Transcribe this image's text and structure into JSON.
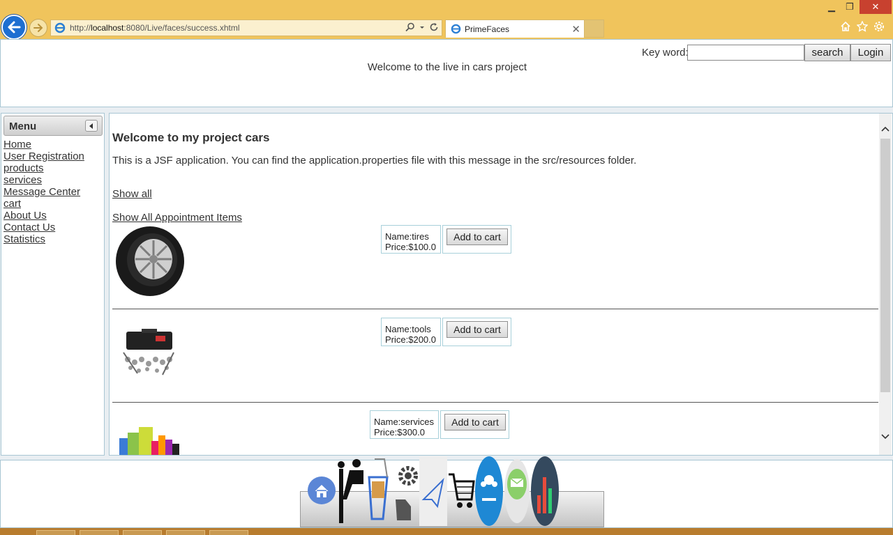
{
  "browser": {
    "url_prefix": "http://",
    "url_host": "localhost",
    "url_rest": ":8080/Live/faces/success.xhtml",
    "tab_title": "PrimeFaces",
    "accent": "#f0c45c"
  },
  "header": {
    "keyword_label": "Key word:",
    "keyword_value": "",
    "search_label": "search",
    "login_label": "Login",
    "welcome": "Welcome to the live in cars project"
  },
  "menu": {
    "title": "Menu",
    "items": [
      "Home",
      "User Registration",
      "products",
      "services",
      "Message Center",
      "cart",
      "About Us",
      "Contact Us",
      "Statistics"
    ]
  },
  "content": {
    "title": "Welcome to my project cars",
    "description": "This is a JSF application. You can find the application.properties file with this message in the src/resources folder.",
    "show_all": "Show all",
    "show_appointments": "Show All Appointment Items",
    "add_to_cart_label": "Add to cart",
    "products": [
      {
        "name": "Name:tires",
        "price": "Price:$100.0",
        "image": "tire-image"
      },
      {
        "name": "Name:tools",
        "price": "Price:$200.0",
        "image": "toolkit-image"
      },
      {
        "name": "Name:services",
        "price": "Price:$300.0",
        "image": "car-care-products-image"
      }
    ]
  },
  "footer": {
    "dock_icons": [
      "home-icon",
      "user-registration-icon",
      "products-icon",
      "services-icon",
      "message-icon",
      "cart-icon",
      "about-us-icon",
      "contact-us-icon",
      "statistics-icon"
    ]
  }
}
